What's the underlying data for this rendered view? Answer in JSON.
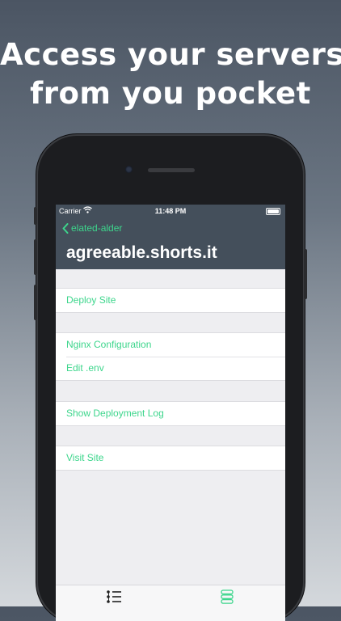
{
  "headline": {
    "line1": "Access your servers",
    "line2": "from you pocket"
  },
  "status_bar": {
    "carrier": "Carrier",
    "time": "11:48 PM"
  },
  "nav": {
    "back_label": "elated-alder",
    "title": "agreeable.shorts.it"
  },
  "groups": [
    {
      "items": [
        "Deploy Site"
      ]
    },
    {
      "items": [
        "Nginx Configuration",
        "Edit .env"
      ]
    },
    {
      "items": [
        "Show Deployment Log"
      ]
    },
    {
      "items": [
        "Visit Site"
      ]
    }
  ],
  "colors": {
    "accent": "#3dd68c",
    "navbar": "#444f5b",
    "background": "#eeeef1"
  },
  "tab_bar": {
    "tabs": [
      {
        "icon": "list-icon",
        "selected": true
      },
      {
        "icon": "servers-icon",
        "selected": false
      }
    ]
  }
}
